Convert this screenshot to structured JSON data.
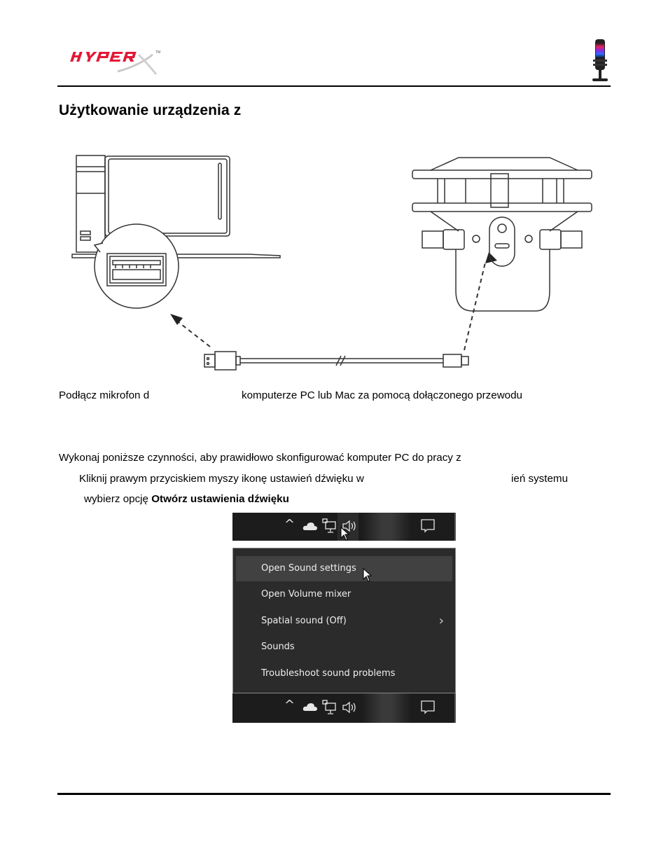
{
  "header": {
    "brand": "HYPERX",
    "brand_color": "#e31837",
    "product_image": "microphone-rgb"
  },
  "page_title": "Użytkowanie urządzenia z",
  "diagram": {
    "left_device": "desktop-computer-with-usb-a-port",
    "right_device": "microphone-with-usb-c-port",
    "cable": "usb-a-to-usb-c-cable"
  },
  "instructions": {
    "connect_part1": "Podłącz mikrofon d",
    "connect_part2": "komputerze PC lub Mac za pomocą dołączonego przewodu",
    "configure_intro": "Wykonaj poniższe czynności, aby prawidłowo skonfigurować komputer PC do pracy z",
    "step1_part1": "Kliknij prawym przyciskiem myszy ikonę ustawień dźwięku w",
    "step1_part2": "ień systemu",
    "step1_line2_prefix": "wybierz opcję ",
    "step1_line2_bold": "Otwórz ustawienia dźwięku"
  },
  "screenshot": {
    "tray_icons": [
      "chevron-up-icon",
      "cloud-icon",
      "network-icon",
      "speaker-icon",
      "notification-icon"
    ],
    "tray_glyphs": {
      "chevron": "^",
      "speaker": "🔊︎",
      "notification": "🗨"
    },
    "menu_items": [
      {
        "label": "Open Sound settings",
        "highlighted": true
      },
      {
        "label": "Open Volume mixer"
      },
      {
        "label": "Spatial sound (Off)",
        "submenu": true
      },
      {
        "label": "Sounds"
      },
      {
        "label": "Troubleshoot sound problems"
      }
    ],
    "submenu_glyph": "›"
  }
}
